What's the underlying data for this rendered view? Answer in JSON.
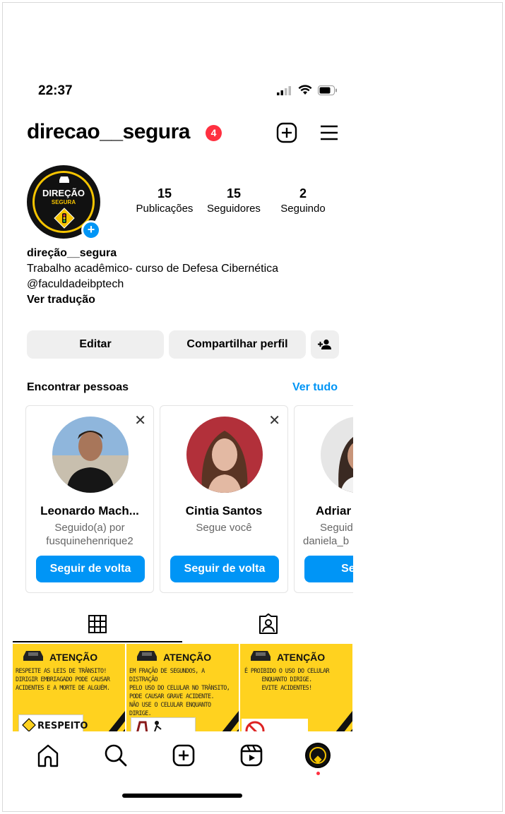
{
  "status_bar": {
    "time": "22:37"
  },
  "profile": {
    "username": "direcao__segura",
    "notification_count": "4",
    "avatar_text_top": "DIREÇÃO",
    "avatar_text_bottom": "SEGURA",
    "stats": [
      {
        "value": "15",
        "label": "Publicações"
      },
      {
        "value": "15",
        "label": "Seguidores"
      },
      {
        "value": "2",
        "label": "Seguindo"
      }
    ],
    "display_name": "direção__segura",
    "bio_line": "Trabalho acadêmico- curso de Defesa Cibernética",
    "bio_handle": "@faculdadeibptech",
    "translate_link": "Ver tradução"
  },
  "actions": {
    "edit_label": "Editar",
    "share_label": "Compartilhar perfil"
  },
  "suggestions": {
    "title": "Encontrar pessoas",
    "see_all": "Ver tudo",
    "cards": [
      {
        "name": "Leonardo Mach...",
        "sub1": "Seguido(a) por",
        "sub2": "fusquinehenrique2",
        "button": "Seguir de volta"
      },
      {
        "name": "Cintia Santos",
        "sub1": "Segue você",
        "sub2": "",
        "button": "Seguir de volta"
      },
      {
        "name": "Adriar",
        "sub1": "Seguid",
        "sub2": "daniela_b",
        "button": "Seguir"
      }
    ]
  },
  "posts": [
    {
      "heading": "ATENÇÃO",
      "lines": [
        "RESPEITE AS LEIS DE TRÂNSITO!",
        "DIRIGIR EMBRIAGADO PODE CAUSAR",
        "ACIDENTES E A MORTE DE ALGUÉM."
      ],
      "footer": "RESPEITO"
    },
    {
      "heading": "ATENÇÃO",
      "lines": [
        "EM FRAÇÃO DE SEGUNDOS, A DISTRAÇÃO",
        "PELO USO DO CELULAR NO TRÂNSITO,",
        "PODE CAUSAR GRAVE ACIDENTE.",
        "NÃO USE O CELULAR ENQUANTO DIRIGE."
      ],
      "footer": ""
    },
    {
      "heading": "ATENÇÃO",
      "lines": [
        "É PROIBIDO O USO DO CELULAR",
        "ENQUANTO DIRIGE.",
        "EVITE ACIDENTES!"
      ],
      "footer": ""
    }
  ],
  "colors": {
    "accent": "#0095f6",
    "badge": "#ff3040",
    "post_bg": "#ffd21f",
    "button_bg": "#efefef"
  },
  "icons": [
    "signal-icon",
    "wifi-icon",
    "battery-icon",
    "new-post-icon",
    "menu-icon",
    "add-person-icon",
    "grid-icon",
    "tagged-icon",
    "home-icon",
    "search-icon",
    "create-icon",
    "reels-icon",
    "profile-avatar-icon"
  ]
}
